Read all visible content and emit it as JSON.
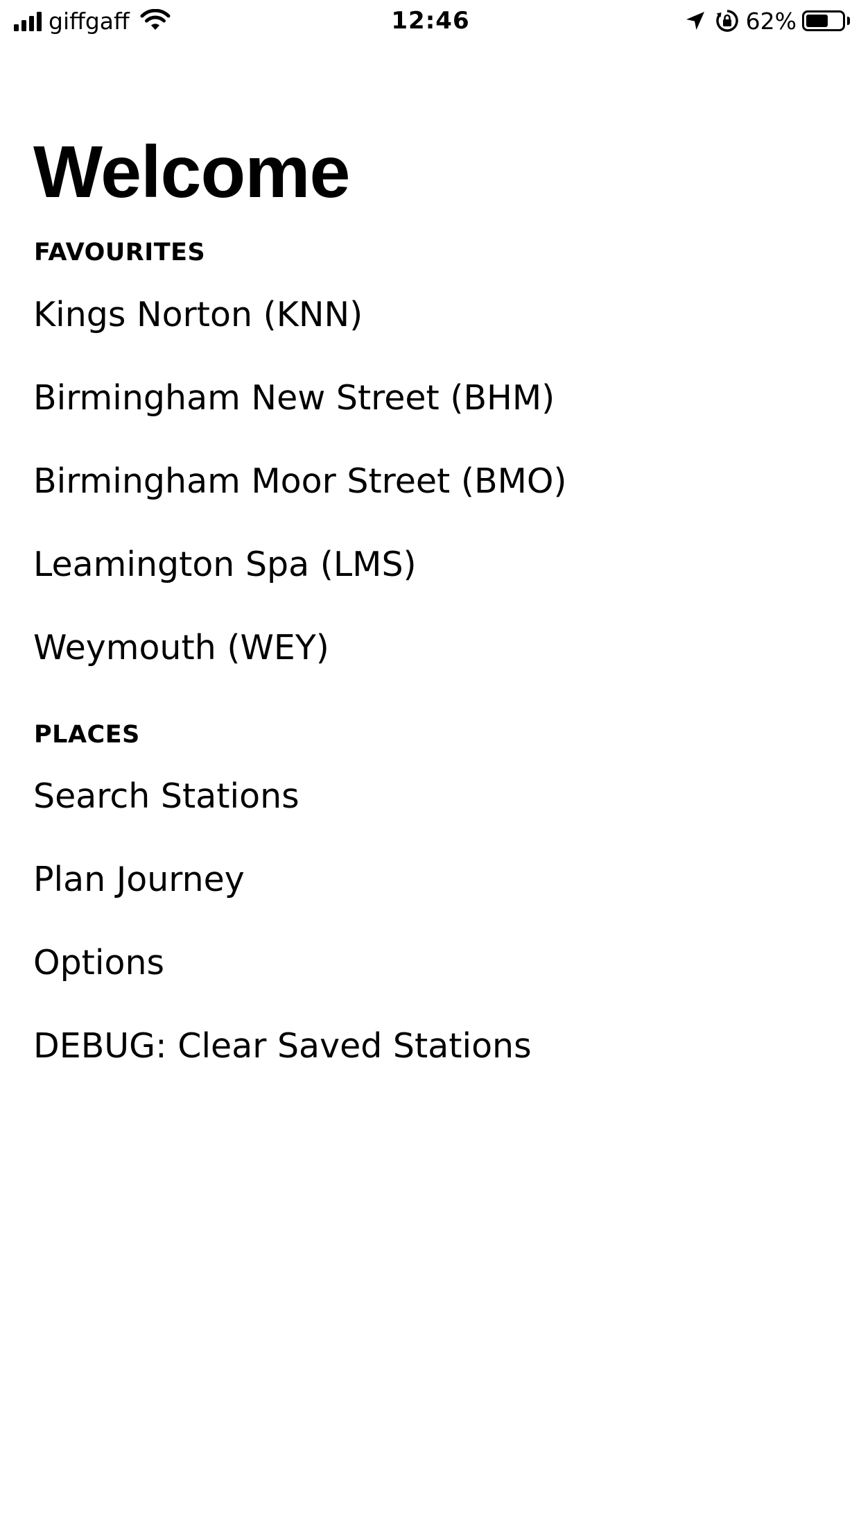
{
  "status_bar": {
    "carrier": "giffgaff",
    "time": "12:46",
    "battery_percent_label": "62%",
    "battery_level": 0.62
  },
  "title": "Welcome",
  "favourites": {
    "header": "FAVOURITES",
    "items": [
      {
        "label": "Kings Norton (KNN)"
      },
      {
        "label": "Birmingham New Street (BHM)"
      },
      {
        "label": "Birmingham Moor Street (BMO)"
      },
      {
        "label": "Leamington Spa (LMS)"
      },
      {
        "label": "Weymouth (WEY)"
      }
    ]
  },
  "places": {
    "header": "PLACES",
    "items": [
      {
        "label": "Search Stations"
      },
      {
        "label": "Plan Journey"
      },
      {
        "label": "Options"
      },
      {
        "label": "DEBUG: Clear Saved Stations"
      }
    ]
  },
  "icons": {
    "signal": "cellular-signal-icon",
    "wifi": "wifi-icon",
    "location": "location-arrow-icon",
    "rotation_lock": "rotation-lock-icon",
    "battery": "battery-icon"
  },
  "colors": {
    "background": "#ffffff",
    "text": "#000000"
  }
}
